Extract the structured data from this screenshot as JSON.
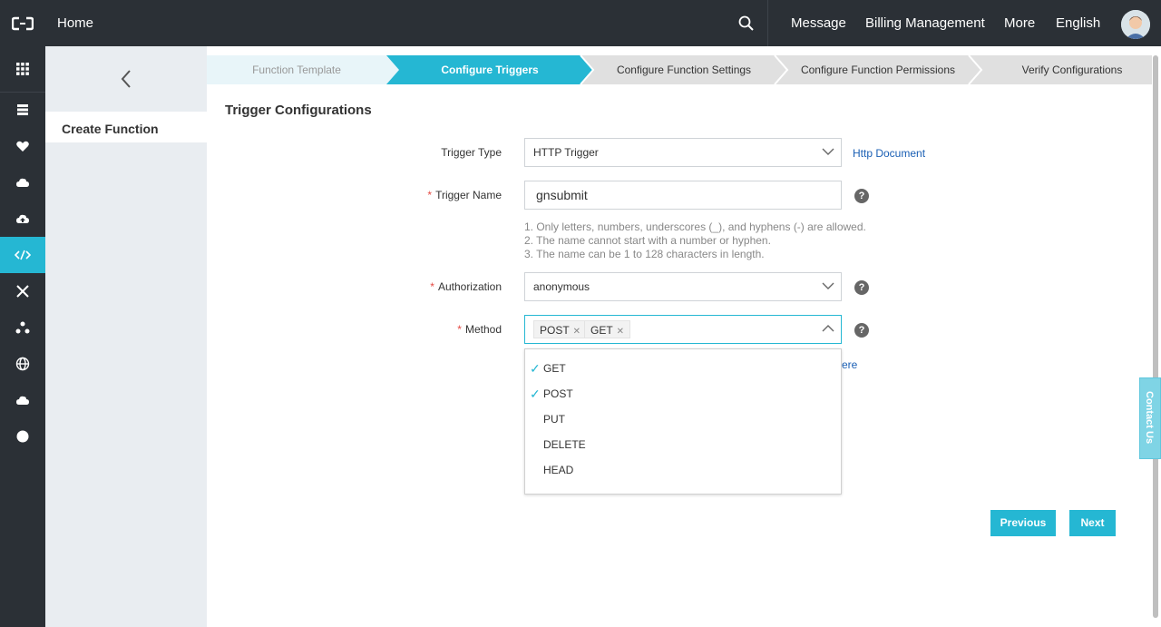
{
  "topbar": {
    "home": "Home",
    "nav": [
      "Message",
      "Billing Management",
      "More",
      "English"
    ],
    "icons": {
      "logo": "aliyun-logo-icon",
      "search": "search-icon",
      "avatar": "avatar"
    }
  },
  "sidenav": {
    "icons": [
      "grid-icon",
      "database-icon",
      "heart-icon",
      "cloud-icon",
      "cloud-upload-icon",
      "function-icon",
      "network-icon",
      "cluster-icon",
      "globe-icon",
      "cloud-sync-icon",
      "circle-icon"
    ],
    "active_index": 5,
    "accent": "#25b7d3"
  },
  "subnav": {
    "current": "Create Function"
  },
  "steps": [
    "Function Template",
    "Configure Triggers",
    "Configure Function Settings",
    "Configure Function Permissions",
    "Verify Configurations"
  ],
  "form": {
    "title": "Trigger Configurations",
    "trigger_type": {
      "label": "Trigger Type",
      "value": "HTTP Trigger",
      "link": "Http Document"
    },
    "trigger_name": {
      "label": "Trigger Name",
      "value": "gnsubmit",
      "hints": [
        "1. Only letters, numbers, underscores (_), and hyphens (-) are allowed.",
        "2. The name cannot start with a number or hyphen.",
        "3. The name can be 1 to 128 characters in length."
      ]
    },
    "authorization": {
      "label": "Authorization",
      "value": "anonymous"
    },
    "method": {
      "label": "Method",
      "tags": [
        "POST",
        "GET"
      ],
      "partial_link": "ere"
    },
    "required_mark": "*",
    "help_glyph": "?"
  },
  "method_options": [
    {
      "label": "GET",
      "checked": true
    },
    {
      "label": "POST",
      "checked": true
    },
    {
      "label": "PUT",
      "checked": false
    },
    {
      "label": "DELETE",
      "checked": false
    },
    {
      "label": "HEAD",
      "checked": false
    }
  ],
  "buttons": {
    "previous": "Previous",
    "next": "Next"
  },
  "contact": "Contact Us",
  "colors": {
    "topbar": "#2b3036",
    "accent": "#25b7d3",
    "subnav": "#e9edf1"
  }
}
